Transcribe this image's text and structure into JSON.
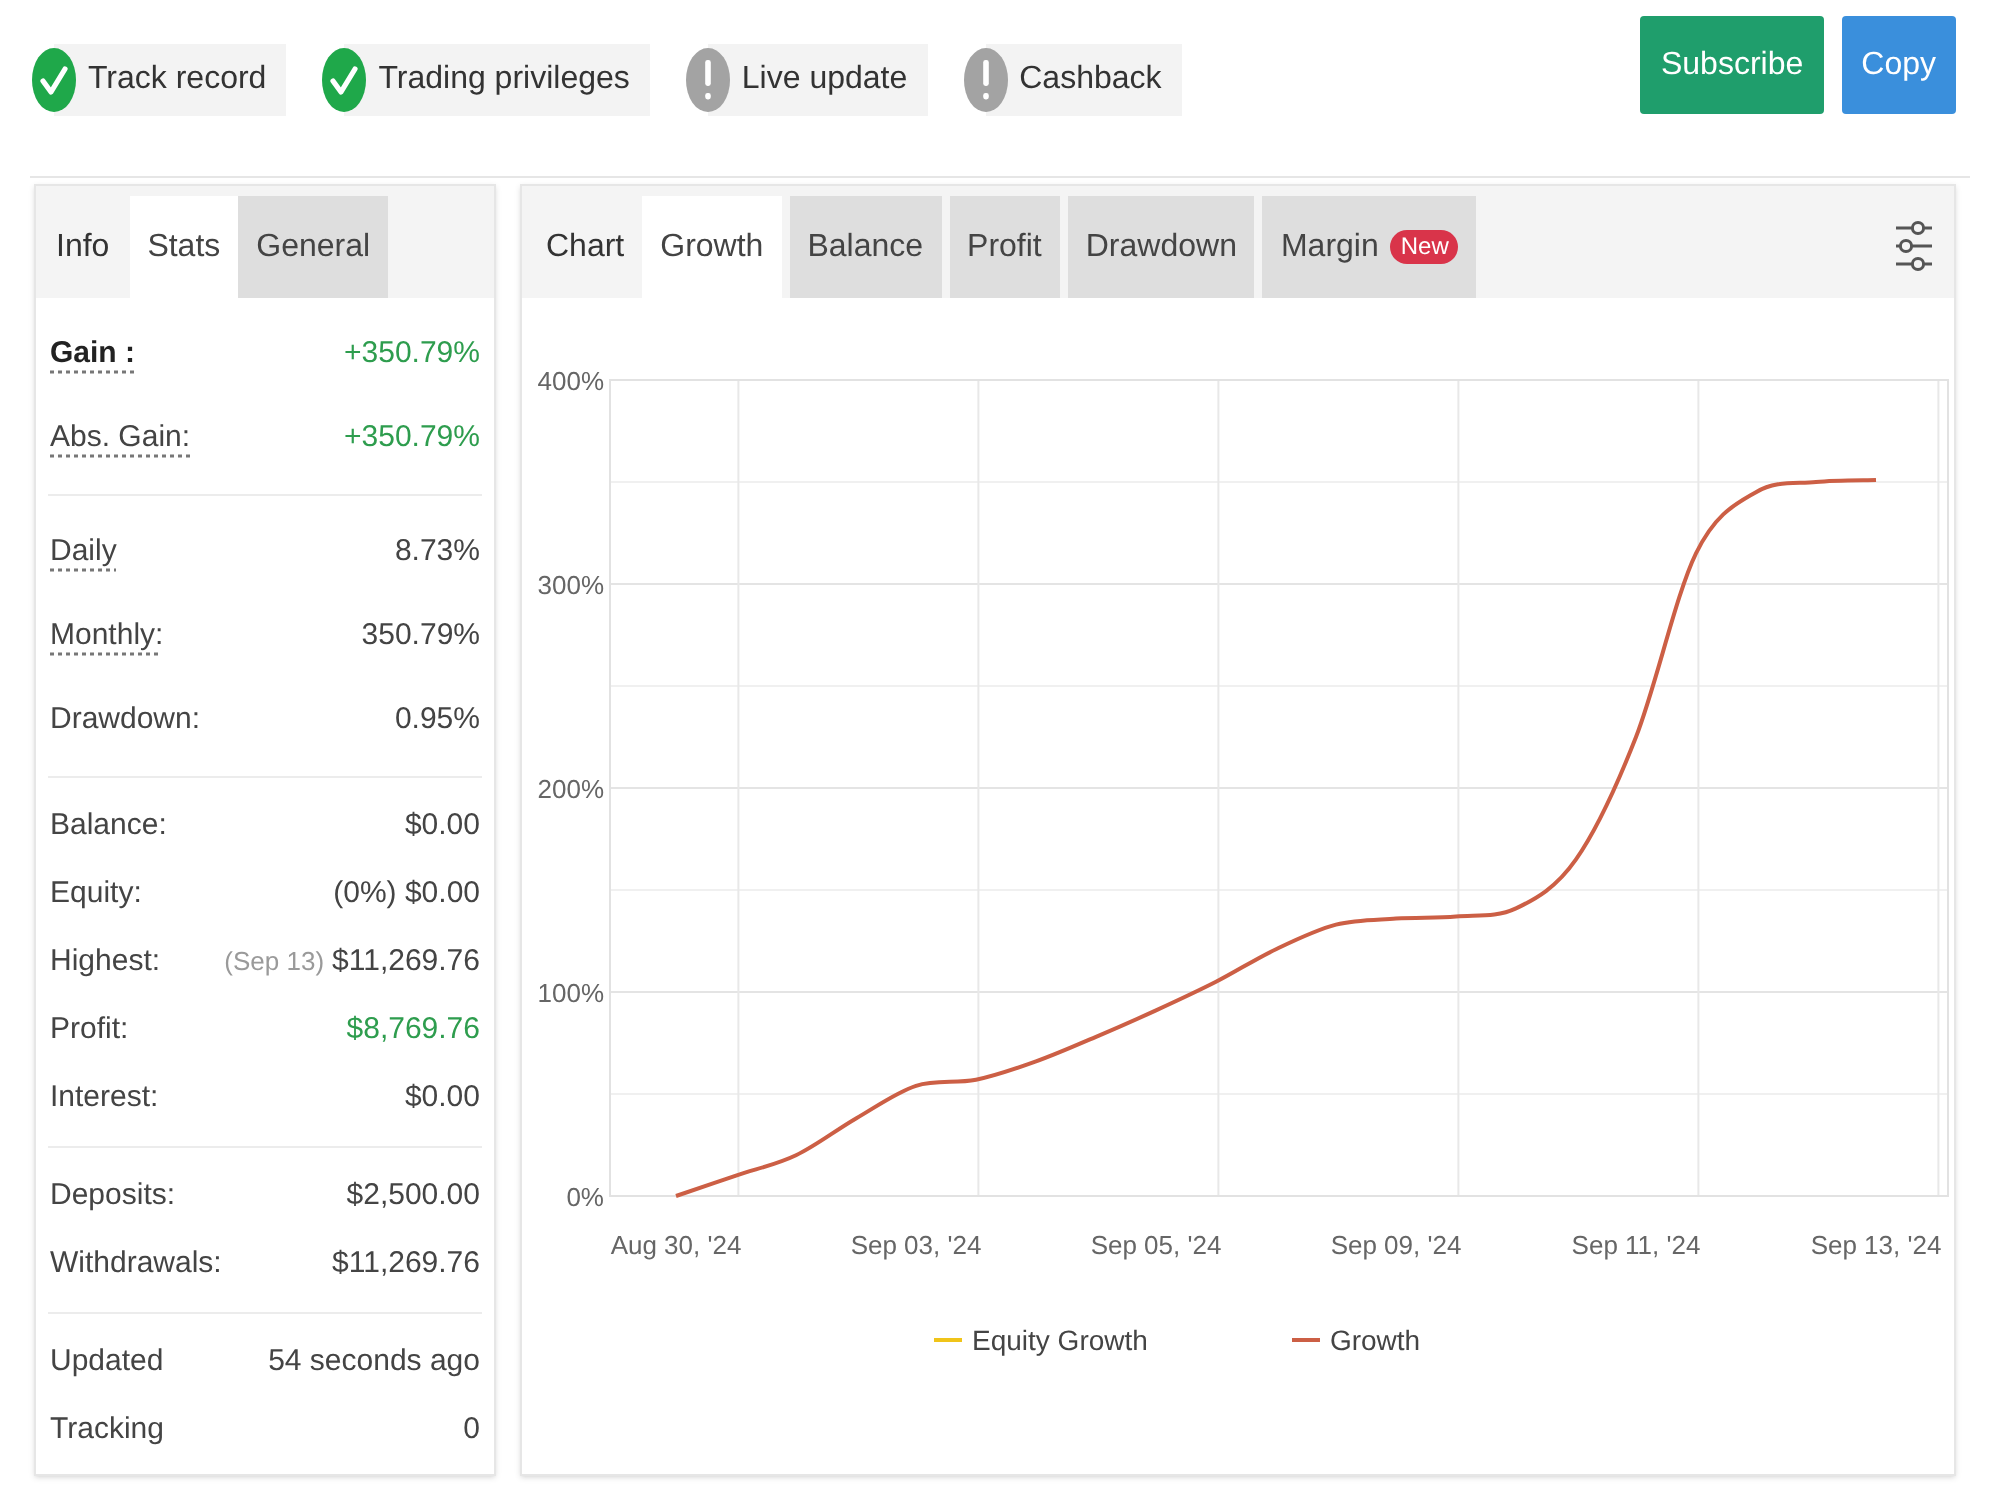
{
  "status_badges": [
    {
      "label": "Track record",
      "verified": true
    },
    {
      "label": "Trading privileges",
      "verified": true
    },
    {
      "label": "Live update",
      "verified": false
    },
    {
      "label": "Cashback",
      "verified": false
    }
  ],
  "actions": [
    {
      "label": "Subscribe",
      "kind": "primary"
    },
    {
      "label": "Copy",
      "kind": "secondary"
    }
  ],
  "stats_panel": {
    "title": "Info",
    "tabs": [
      {
        "label": "Stats",
        "selected": true
      },
      {
        "label": "General",
        "selected": false
      }
    ],
    "groups": [
      {
        "rows": [
          {
            "label": "Gain :",
            "value": "+350.79%",
            "hint": true,
            "strong": true,
            "positive": true
          },
          {
            "label": "Abs. Gain:",
            "value": "+350.79%",
            "hint": true,
            "strong": false,
            "positive": true
          }
        ]
      },
      {
        "rows": [
          {
            "label": "Daily",
            "value": "8.73%",
            "hint": true,
            "strong": false,
            "positive": false
          },
          {
            "label": "Monthly:",
            "value": "350.79%",
            "hint": true,
            "strong": false,
            "positive": false
          },
          {
            "label": "Drawdown:",
            "value": "0.95%",
            "hint": false,
            "strong": false,
            "positive": false
          }
        ]
      },
      {
        "rows": [
          {
            "label": "Balance:",
            "value": "$0.00",
            "hint": false,
            "strong": false,
            "positive": false
          },
          {
            "label": "Equity:",
            "value": "(0%) $0.00",
            "hint": false,
            "strong": false,
            "positive": false
          },
          {
            "label": "Highest:",
            "note": "(Sep 13)",
            "value": "$11,269.76",
            "hint": false,
            "strong": false,
            "positive": false
          },
          {
            "label": "Profit:",
            "value": "$8,769.76",
            "hint": false,
            "strong": false,
            "positive": true
          },
          {
            "label": "Interest:",
            "value": "$0.00",
            "hint": false,
            "strong": false,
            "positive": false
          }
        ]
      },
      {
        "rows": [
          {
            "label": "Deposits:",
            "value": "$2,500.00",
            "hint": false,
            "strong": false,
            "positive": false
          },
          {
            "label": "Withdrawals:",
            "value": "$11,269.76",
            "hint": false,
            "strong": false,
            "positive": false
          }
        ]
      },
      {
        "rows": [
          {
            "label": "Updated",
            "value": "54 seconds ago",
            "hint": false,
            "strong": false,
            "positive": false
          },
          {
            "label": "Tracking",
            "value": "0",
            "hint": false,
            "strong": false,
            "positive": false
          }
        ]
      }
    ]
  },
  "chart_panel": {
    "title": "Chart",
    "tabs": [
      {
        "label": "Growth",
        "selected": true
      },
      {
        "label": "Balance",
        "selected": false
      },
      {
        "label": "Profit",
        "selected": false
      },
      {
        "label": "Drawdown",
        "selected": false
      },
      {
        "label": "Margin",
        "selected": false,
        "badge": "New"
      }
    ],
    "chart_data": {
      "type": "line",
      "grid": true,
      "categories": [
        "Aug 30, '24",
        null,
        null,
        null,
        "Sep 03, '24",
        null,
        null,
        null,
        "Sep 05, '24",
        null,
        null,
        null,
        "Sep 09, '24",
        null,
        null,
        null,
        "Sep 11, '24",
        null,
        null,
        null,
        "Sep 13, '24"
      ],
      "ylim": [
        0,
        400
      ],
      "yticks": [
        {
          "value": 0,
          "label": "0%"
        },
        {
          "value": 100,
          "label": "100%"
        },
        {
          "value": 200,
          "label": "200%"
        },
        {
          "value": 300,
          "label": "300%"
        },
        {
          "value": 400,
          "label": "400%"
        }
      ],
      "series": [
        {
          "name": "Equity Growth",
          "color": "#f0c419",
          "values": [
            null,
            null,
            null,
            null,
            null,
            null,
            null,
            null,
            null,
            null,
            null,
            null,
            null,
            null,
            null,
            null,
            null,
            null,
            null,
            null,
            null
          ]
        },
        {
          "name": "Growth",
          "color": "#cc5f45",
          "values": [
            0,
            10,
            20,
            38,
            54,
            57,
            66,
            78,
            91,
            105,
            121,
            133,
            136,
            137,
            141,
            165,
            225,
            315,
            345,
            350,
            351
          ]
        }
      ]
    }
  }
}
